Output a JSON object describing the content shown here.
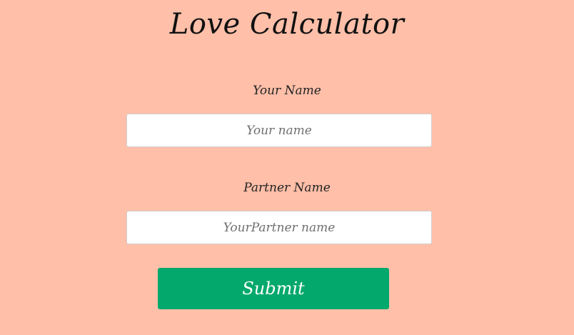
{
  "page": {
    "title": "Love Calculator"
  },
  "form": {
    "name_label": "Your Name",
    "name_placeholder": "Your name",
    "name_value": "",
    "partner_label": "Partner Name",
    "partner_placeholder": "YourPartner name",
    "partner_value": "",
    "submit_label": "Submit"
  },
  "colors": {
    "background": "#ffbfa9",
    "button": "#03a86d",
    "button_text": "#ffffff",
    "input_background": "#ffffff",
    "text": "#111111"
  }
}
